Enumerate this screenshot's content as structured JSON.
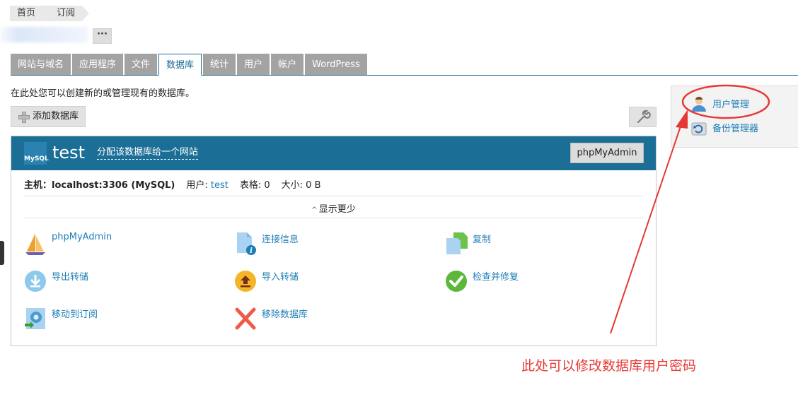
{
  "breadcrumb": [
    "首页",
    "订阅"
  ],
  "more_label": "···",
  "tabs": [
    "网站与域名",
    "应用程序",
    "文件",
    "数据库",
    "统计",
    "用户",
    "帐户",
    "WordPress"
  ],
  "active_tab": "数据库",
  "description": "在此处您可以创建新的或管理现有的数据库。",
  "add_db_label": "添加数据库",
  "db": {
    "logo_text": "MySQL",
    "name": "test",
    "assign_link": "分配该数据库给一个网站",
    "pma_button": "phpMyAdmin",
    "host_label": "主机：",
    "host_value": "localhost:3306 (MySQL)",
    "user_label": "用户:",
    "user_value": "test",
    "tables_label": "表格: 0",
    "size_label": "大小: 0 B",
    "show_less": "显示更少",
    "actions": [
      {
        "label": "phpMyAdmin",
        "icon": "phpmyadmin-sailboat-icon"
      },
      {
        "label": "连接信息",
        "icon": "connection-info-icon"
      },
      {
        "label": "复制",
        "icon": "copy-icon"
      },
      {
        "label": "导出转储",
        "icon": "export-dump-icon"
      },
      {
        "label": "导入转储",
        "icon": "import-dump-icon"
      },
      {
        "label": "检查并修复",
        "icon": "check-repair-icon"
      },
      {
        "label": "移动到订阅",
        "icon": "move-to-subscription-icon"
      },
      {
        "label": "移除数据库",
        "icon": "remove-database-icon"
      }
    ]
  },
  "side": {
    "user_mgmt": "用户管理",
    "backup_mgr": "备份管理器"
  },
  "annotation": "此处可以修改数据库用户密码",
  "colors": {
    "header_blue": "#1b6e95",
    "link_blue": "#1d7db5",
    "annotation_red": "#e53935",
    "tab_gray": "#a3a3a3"
  }
}
